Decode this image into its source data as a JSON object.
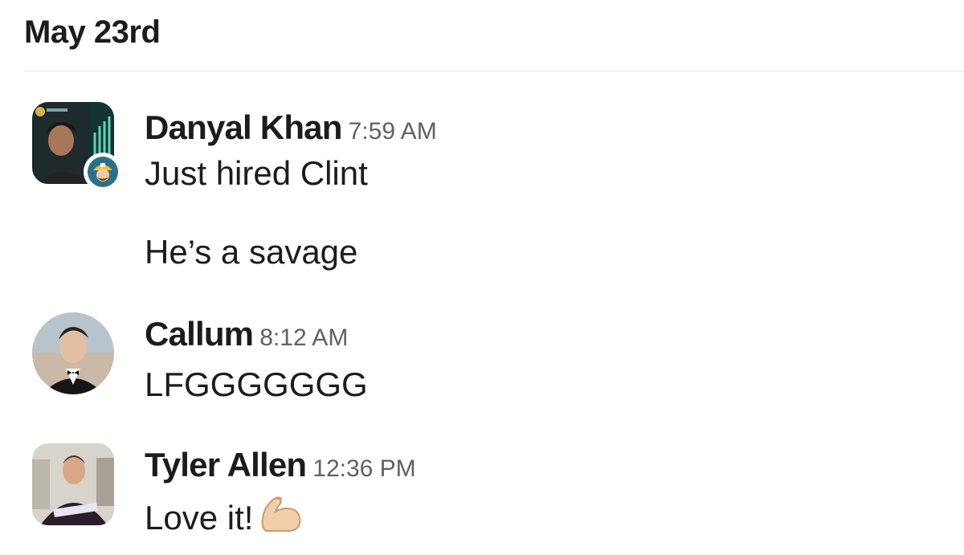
{
  "date_header": "May 23rd",
  "messages": [
    {
      "sender": "Danyal Khan",
      "time": "7:59 AM",
      "lines": [
        "Just hired Clint",
        "He’s a savage"
      ],
      "avatar_icon": "profile-photo-dark",
      "status_badge_icon": "miner-emoji-icon"
    },
    {
      "sender": "Callum",
      "time": "8:12 AM",
      "lines": [
        "LFGGGGGGG"
      ],
      "avatar_icon": "profile-photo-tuxedo"
    },
    {
      "sender": "Tyler Allen",
      "time": "12:36 PM",
      "lines": [
        "Love it!"
      ],
      "avatar_icon": "profile-photo-jersey",
      "reaction_icon": "flexed-biceps-emoji"
    }
  ],
  "colors": {
    "text_primary": "#1d1c1d",
    "text_timestamp": "#616061",
    "divider": "#e4e4e4"
  }
}
